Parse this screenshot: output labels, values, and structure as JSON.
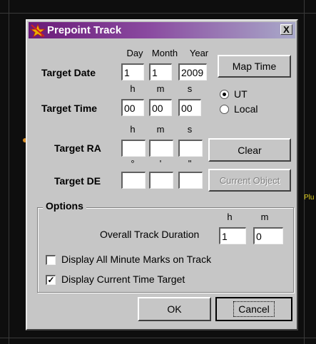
{
  "background": {
    "planet_label": "Plu"
  },
  "dialog": {
    "title": "Prepoint Track",
    "close_glyph": "X",
    "headers": {
      "day": "Day",
      "month": "Month",
      "year": "Year",
      "h": "h",
      "m": "m",
      "s": "s",
      "deg": "°",
      "arcmin": "'",
      "arcsec": "\""
    },
    "target_date": {
      "label": "Target Date",
      "day": "1",
      "month": "1",
      "year": "2009"
    },
    "target_time": {
      "label": "Target Time",
      "h": "00",
      "m": "00",
      "s": "00"
    },
    "time_mode": {
      "ut_label": "UT",
      "local_label": "Local",
      "selected": "UT"
    },
    "target_ra": {
      "label": "Target RA",
      "h": "",
      "m": "",
      "s": ""
    },
    "target_de": {
      "label": "Target DE",
      "deg": "",
      "arcmin": "",
      "arcsec": ""
    },
    "buttons": {
      "map_time": "Map Time",
      "clear": "Clear",
      "current_object": "Current Object",
      "ok": "OK",
      "cancel": "Cancel"
    },
    "options": {
      "title": "Options",
      "duration_label": "Overall Track Duration",
      "duration_h_header": "h",
      "duration_m_header": "m",
      "duration_h": "1",
      "duration_m": "0",
      "minute_marks_label": "Display All Minute Marks on Track",
      "minute_marks_checked": false,
      "current_time_label": "Display Current Time Target",
      "current_time_checked": true,
      "check_glyph": "✓"
    }
  }
}
